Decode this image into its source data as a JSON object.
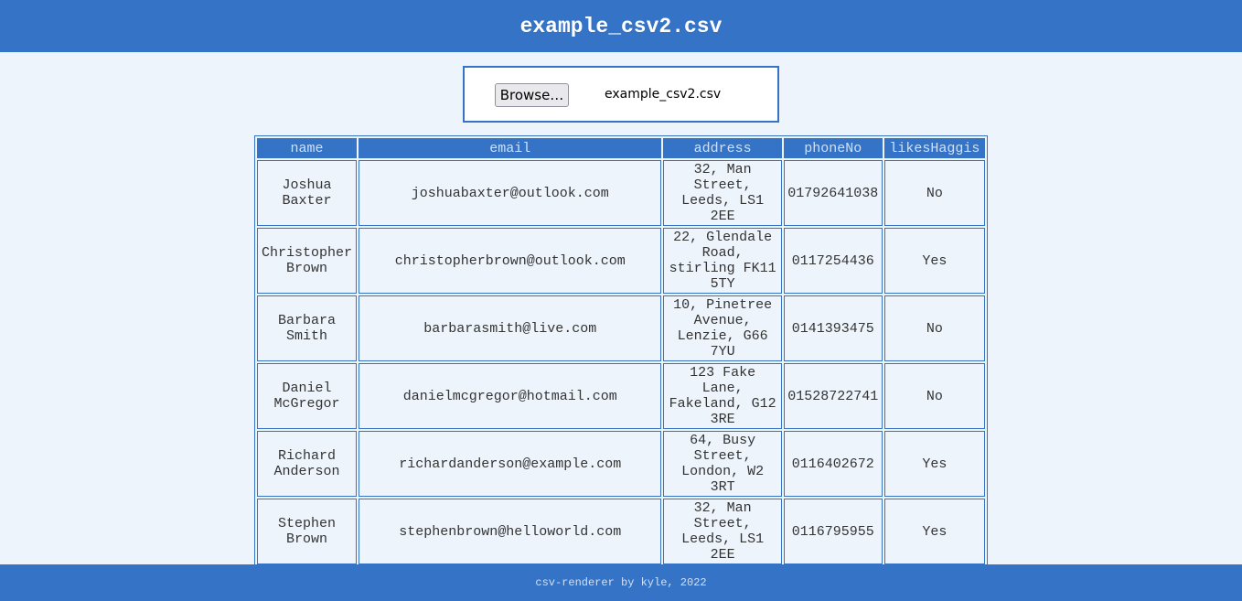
{
  "header": {
    "title": "example_csv2.csv"
  },
  "upload": {
    "browse_label": "Browse…",
    "file_name": "example_csv2.csv"
  },
  "table": {
    "columns": [
      "name",
      "email",
      "address",
      "phoneNo",
      "likesHaggis"
    ],
    "rows": [
      [
        "Joshua Baxter",
        "joshuabaxter@outlook.com",
        "32, Man Street, Leeds, LS1 2EE",
        "01792641038",
        "No"
      ],
      [
        "Christopher Brown",
        "christopherbrown@outlook.com",
        "22, Glendale Road, stirling FK11 5TY",
        "0117254436",
        "Yes"
      ],
      [
        "Barbara Smith",
        "barbarasmith@live.com",
        "10, Pinetree Avenue, Lenzie, G66 7YU",
        "0141393475",
        "No"
      ],
      [
        "Daniel McGregor",
        "danielmcgregor@hotmail.com",
        "123 Fake Lane, Fakeland, G12 3RE",
        "01528722741",
        "No"
      ],
      [
        "Richard Anderson",
        "richardanderson@example.com",
        "64, Busy Street, London, W2 3RT",
        "0116402672",
        "Yes"
      ],
      [
        "Stephen Brown",
        "stephenbrown@helloworld.com",
        "32, Man Street, Leeds, LS1 2EE",
        "0116795955",
        "Yes"
      ]
    ]
  },
  "footer": {
    "text": "csv-renderer by kyle, 2022"
  }
}
